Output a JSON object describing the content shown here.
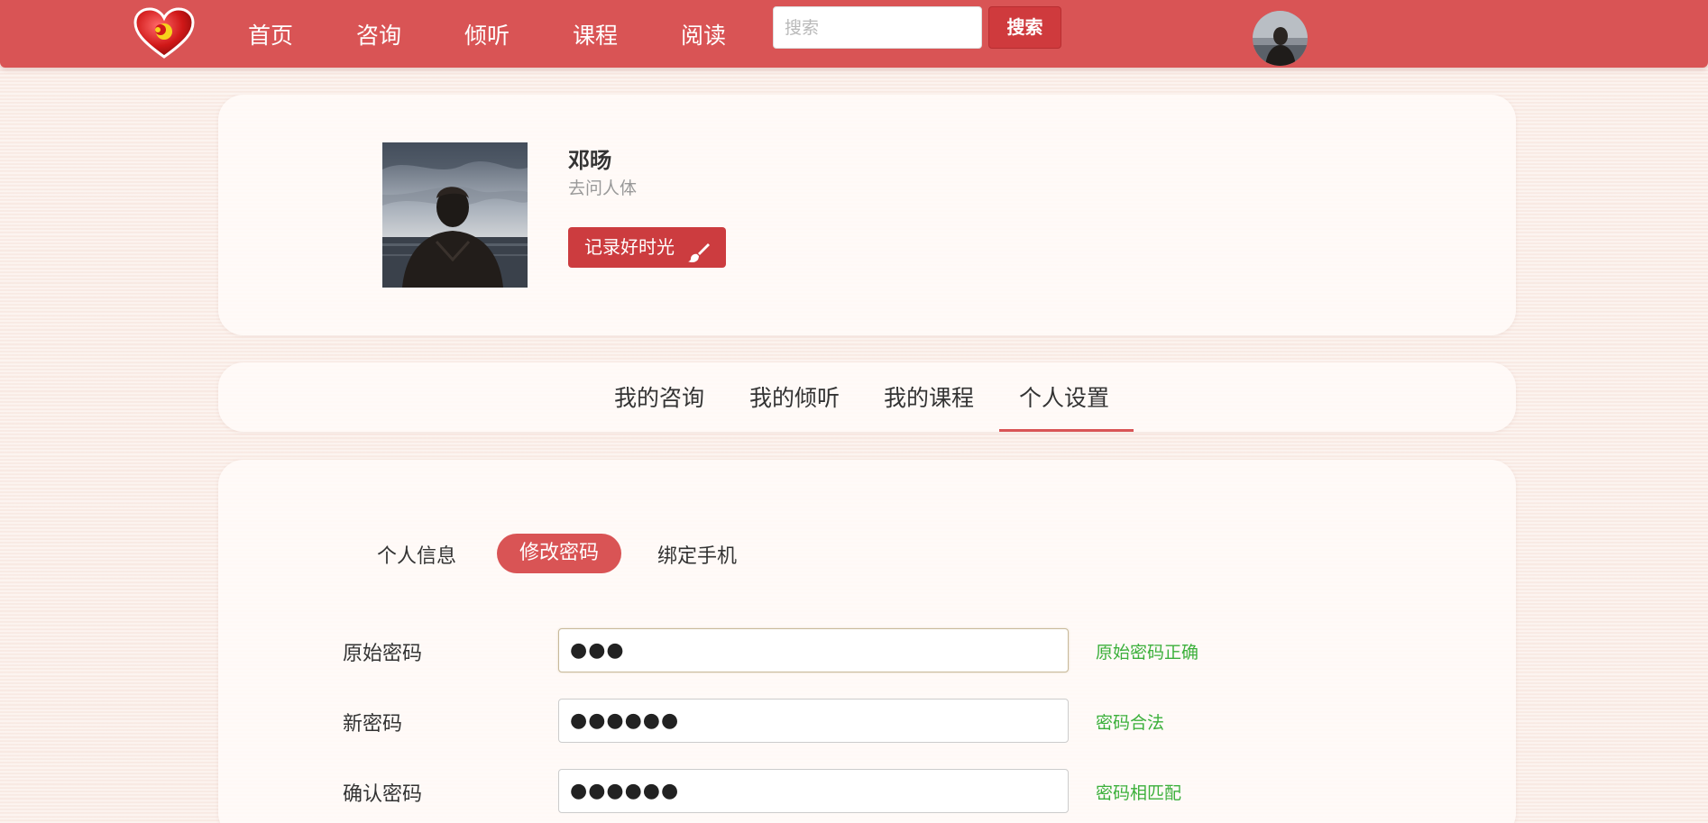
{
  "nav": {
    "items": [
      "首页",
      "咨询",
      "倾听",
      "课程",
      "阅读"
    ],
    "search_placeholder": "搜索",
    "search_button": "搜索"
  },
  "profile": {
    "name": "邓旸",
    "subtitle": "去问人体",
    "record_button": "记录好时光"
  },
  "tabs": {
    "items": [
      "我的咨询",
      "我的倾听",
      "我的课程",
      "个人设置"
    ],
    "active": "个人设置"
  },
  "settings": {
    "subtabs": [
      "个人信息",
      "修改密码",
      "绑定手机"
    ],
    "active_subtab": "修改密码",
    "fields": [
      {
        "label": "原始密码",
        "value": "●●●",
        "status": "原始密码正确"
      },
      {
        "label": "新密码",
        "value": "●●●●●●",
        "status": "密码合法"
      },
      {
        "label": "确认密码",
        "value": "●●●●●●",
        "status": "密码相匹配"
      }
    ]
  },
  "colors": {
    "brand": "#d95455",
    "button": "#cc3c3f",
    "success": "#3bb03b"
  }
}
